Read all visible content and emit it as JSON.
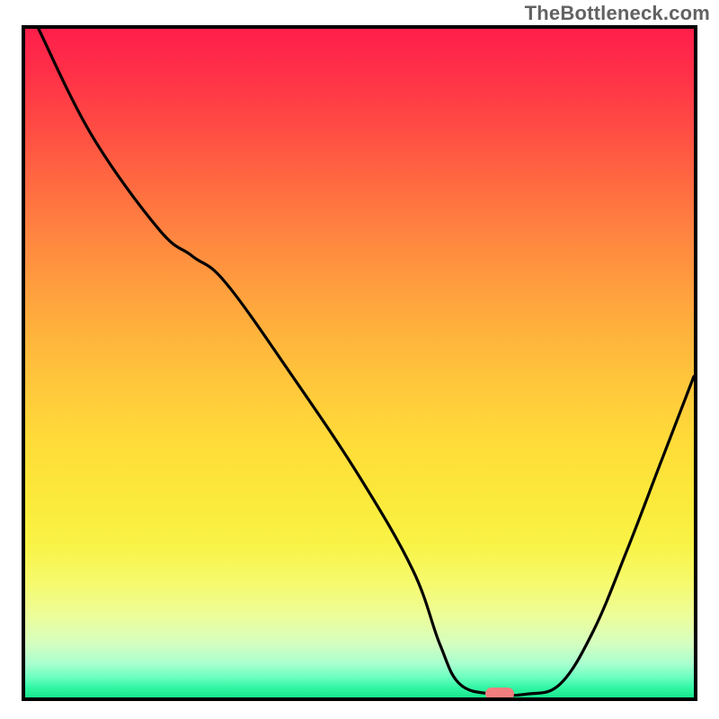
{
  "watermark": "TheBottleneck.com",
  "chart_data": {
    "type": "line",
    "title": "",
    "xlabel": "",
    "ylabel": "",
    "xlim": [
      0,
      100
    ],
    "ylim": [
      0,
      100
    ],
    "series": [
      {
        "name": "bottleneck-curve",
        "x": [
          2,
          10,
          20,
          25,
          30,
          40,
          50,
          58,
          62,
          65,
          70,
          75,
          80,
          85,
          90,
          95,
          100
        ],
        "y": [
          100,
          84,
          70,
          66,
          62,
          48,
          33,
          19,
          8,
          2,
          0.5,
          0.5,
          2,
          10,
          22,
          35,
          48
        ]
      }
    ],
    "marker_point": {
      "x": 71,
      "y": 0.5
    },
    "background_gradient": {
      "top_color": "#ff1f4b",
      "mid_color": "#ffdc39",
      "bottom_color": "#17e98e"
    }
  }
}
